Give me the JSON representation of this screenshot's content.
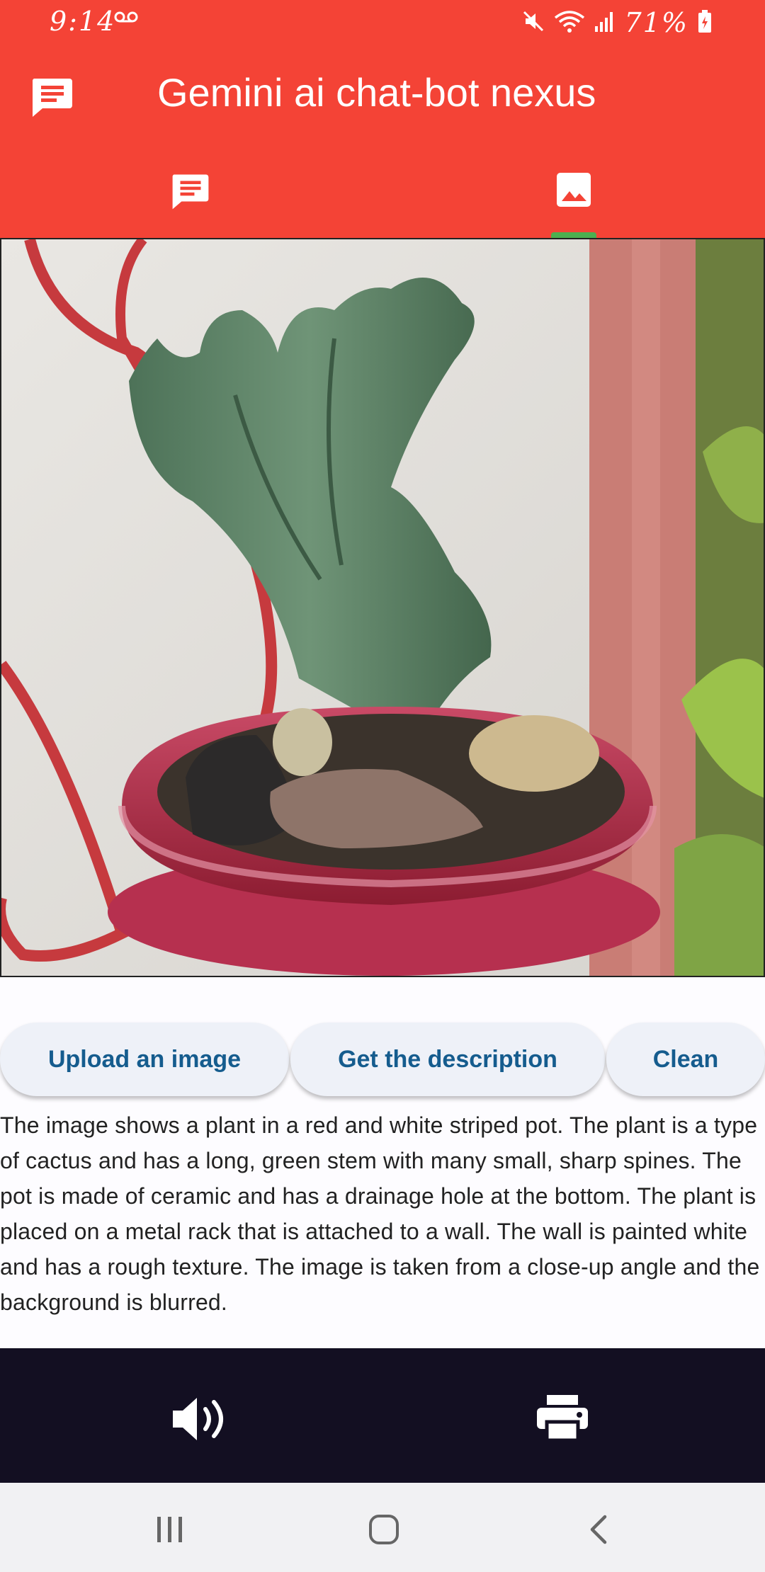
{
  "status_bar": {
    "time": "9:14",
    "battery_percent": "71%"
  },
  "app_bar": {
    "title": "Gemini ai chat-bot nexus",
    "background_color": "#f44336",
    "icon": "chat-icon",
    "tabs": [
      {
        "icon": "chat-icon",
        "selected": false
      },
      {
        "icon": "image-icon",
        "selected": true
      }
    ],
    "indicator_color": "#4caf50"
  },
  "image_view": {
    "content": "photo-cactus-in-red-pot"
  },
  "buttons": {
    "upload": "Upload an image",
    "describe": "Get the description",
    "clean": "Clean"
  },
  "description": " The image shows a plant in a red and white striped pot. The plant is a type of cactus and has a long, green stem with many small, sharp spines. The pot is made of ceramic and has a drainage hole at the bottom. The plant is placed on a metal rack that is attached to a wall. The wall is painted white and has a rough texture. The image is taken from a close-up angle and the background is blurred.",
  "bottom_bar": {
    "background_color": "#130f22",
    "actions": [
      "volume-icon",
      "print-icon"
    ]
  },
  "system_nav": [
    "recents-icon",
    "home-icon",
    "back-icon"
  ]
}
